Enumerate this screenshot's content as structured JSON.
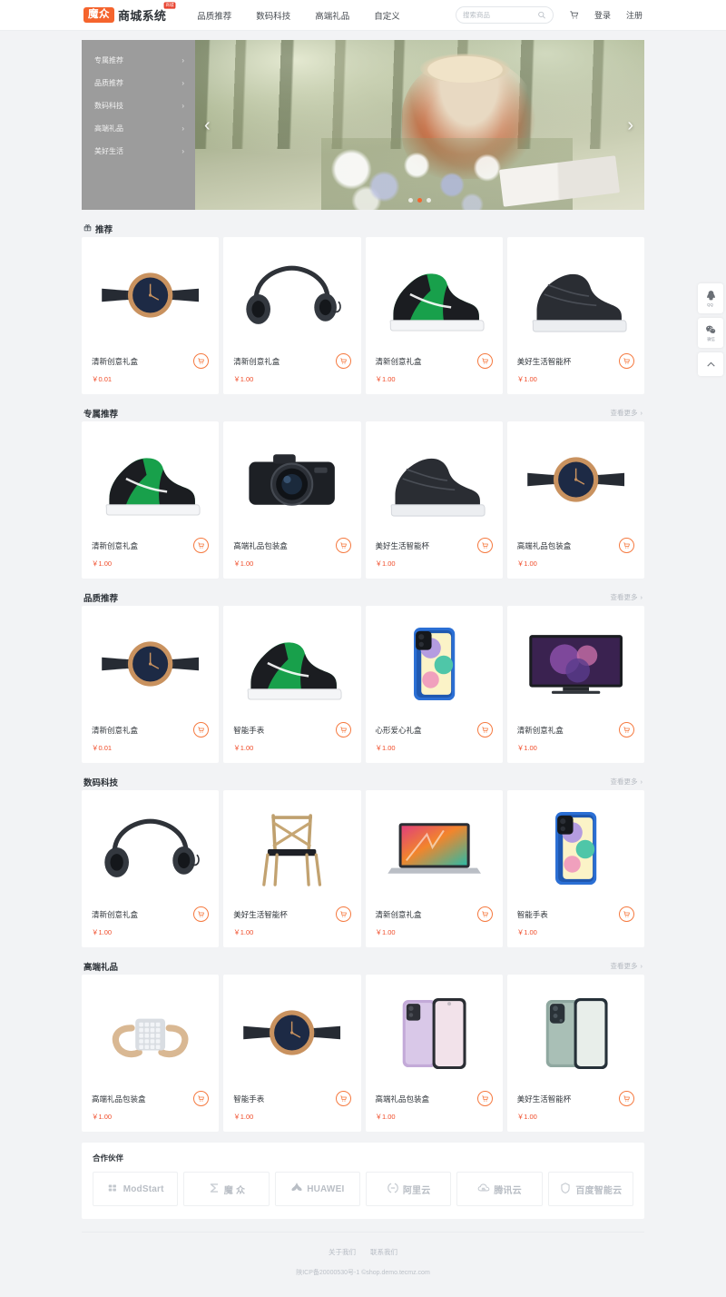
{
  "header": {
    "brand_mark": "魔众",
    "brand_name": "商城系统",
    "brand_badge": "商城",
    "nav": [
      {
        "label": "品质推荐"
      },
      {
        "label": "数码科技"
      },
      {
        "label": "高端礼品"
      },
      {
        "label": "自定义"
      }
    ],
    "search": {
      "placeholder": "搜索商品",
      "value": "",
      "icon": "search-icon"
    },
    "cart_icon": "cart-icon",
    "login_label": "登录",
    "register_label": "注册"
  },
  "banner": {
    "menu": [
      {
        "label": "专属推荐",
        "chevron": "›"
      },
      {
        "label": "品质推荐",
        "chevron": "›"
      },
      {
        "label": "数码科技",
        "chevron": "›"
      },
      {
        "label": "高端礼品",
        "chevron": "›"
      },
      {
        "label": "美好生活",
        "chevron": "›"
      }
    ],
    "prev_arrow": "‹",
    "next_arrow": "›",
    "dots": 3,
    "active_dot": 1,
    "active_dot_color": "#f5642d"
  },
  "sections": [
    {
      "title": "推荐",
      "icon": "gift-icon",
      "more_label": "",
      "products": [
        {
          "name": "清新创意礼盒",
          "price": "￥0.01",
          "image": "watch"
        },
        {
          "name": "清新创意礼盒",
          "price": "￥1.00",
          "image": "headphones"
        },
        {
          "name": "清新创意礼盒",
          "price": "￥1.00",
          "image": "sneaker"
        },
        {
          "name": "美好生活智能杯",
          "price": "￥1.00",
          "image": "boot"
        }
      ]
    },
    {
      "title": "专属推荐",
      "icon": "",
      "more_label": "查看更多",
      "products": [
        {
          "name": "清新创意礼盒",
          "price": "￥1.00",
          "image": "sneaker"
        },
        {
          "name": "高端礼品包装盒",
          "price": "￥1.00",
          "image": "camera"
        },
        {
          "name": "美好生活智能杯",
          "price": "￥1.00",
          "image": "boot"
        },
        {
          "name": "高端礼品包装盒",
          "price": "￥1.00",
          "image": "watch"
        }
      ]
    },
    {
      "title": "品质推荐",
      "icon": "",
      "more_label": "查看更多",
      "products": [
        {
          "name": "清新创意礼盒",
          "price": "￥0.01",
          "image": "watch"
        },
        {
          "name": "智能手表",
          "price": "￥1.00",
          "image": "sneaker"
        },
        {
          "name": "心形爱心礼盒",
          "price": "￥1.00",
          "image": "phone-blue"
        },
        {
          "name": "清新创意礼盒",
          "price": "￥1.00",
          "image": "tv"
        }
      ]
    },
    {
      "title": "数码科技",
      "icon": "",
      "more_label": "查看更多",
      "products": [
        {
          "name": "清新创意礼盒",
          "price": "￥1.00",
          "image": "headphones"
        },
        {
          "name": "美好生活智能杯",
          "price": "￥1.00",
          "image": "chair"
        },
        {
          "name": "清新创意礼盒",
          "price": "￥1.00",
          "image": "laptop"
        },
        {
          "name": "智能手表",
          "price": "￥1.00",
          "image": "phone-blue"
        }
      ]
    },
    {
      "title": "高端礼品",
      "icon": "",
      "more_label": "查看更多",
      "products": [
        {
          "name": "高端礼品包装盒",
          "price": "￥1.00",
          "image": "bracelet"
        },
        {
          "name": "智能手表",
          "price": "￥1.00",
          "image": "watch"
        },
        {
          "name": "高端礼品包装盒",
          "price": "￥1.00",
          "image": "phone-purple"
        },
        {
          "name": "美好生活智能杯",
          "price": "￥1.00",
          "image": "phone-green"
        }
      ]
    }
  ],
  "partners": {
    "title": "合作伙伴",
    "items": [
      {
        "name": "ModStart",
        "icon": "modstart-icon"
      },
      {
        "name": "魔 众",
        "icon": "mozhong-icon"
      },
      {
        "name": "HUAWEI",
        "icon": "huawei-icon"
      },
      {
        "name": "阿里云",
        "icon": "aliyun-icon"
      },
      {
        "name": "腾讯云",
        "icon": "tencent-cloud-icon"
      },
      {
        "name": "百度智能云",
        "icon": "baidu-cloud-icon"
      }
    ]
  },
  "footer": {
    "links": [
      {
        "label": "关于我们"
      },
      {
        "label": "联系我们"
      }
    ],
    "copyright": "陕ICP备20000530号-1 ©shop.demo.tecmz.com"
  },
  "float_bar": {
    "qq_label": "QQ",
    "wechat_label": "微信",
    "top_icon": "chevron-up-icon"
  },
  "more_chevron": "›"
}
